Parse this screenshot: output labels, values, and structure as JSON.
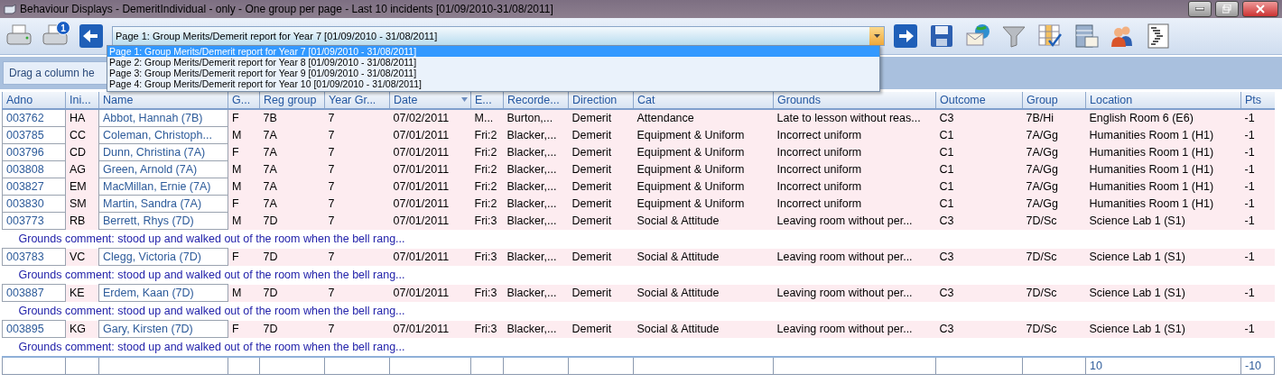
{
  "window": {
    "title": "Behaviour Displays - DemeritIndividual - only - One group per page - Last 10 incidents [01/09/2010-31/08/2011]"
  },
  "toolbar": {
    "print_badge": "1",
    "page_select": {
      "value": "Page 1: Group Merits/Demerit report for Year  7 [01/09/2010 - 31/08/2011]",
      "expanded": true,
      "options": [
        {
          "label": "Page 1: Group Merits/Demerit report for Year  7 [01/09/2010 - 31/08/2011]",
          "selected": true
        },
        {
          "label": "Page 2: Group Merits/Demerit report for Year  8 [01/09/2010 - 31/08/2011]",
          "selected": false
        },
        {
          "label": "Page 3: Group Merits/Demerit report for Year  9 [01/09/2010 - 31/08/2011]",
          "selected": false
        },
        {
          "label": "Page 4: Group Merits/Demerit report for Year 10 [01/09/2010 - 31/08/2011]",
          "selected": false
        }
      ]
    }
  },
  "group_panel": {
    "hint": "Drag a column he"
  },
  "table": {
    "columns": [
      {
        "label": "Adno",
        "link": true,
        "sorted": false
      },
      {
        "label": "Ini...",
        "link": false,
        "sorted": false
      },
      {
        "label": "Name",
        "link": true,
        "sorted": false
      },
      {
        "label": "G...",
        "link": false,
        "sorted": false
      },
      {
        "label": "Reg group",
        "link": false,
        "sorted": false
      },
      {
        "label": "Year Gr...",
        "link": false,
        "sorted": false
      },
      {
        "label": "Date",
        "link": false,
        "sorted": true
      },
      {
        "label": "E...",
        "link": false,
        "sorted": false
      },
      {
        "label": "Recorde...",
        "link": false,
        "sorted": false
      },
      {
        "label": "Direction",
        "link": false,
        "sorted": false
      },
      {
        "label": "Cat",
        "link": false,
        "sorted": false
      },
      {
        "label": "Grounds",
        "link": false,
        "sorted": false
      },
      {
        "label": "Outcome",
        "link": false,
        "sorted": false
      },
      {
        "label": "Group",
        "link": false,
        "sorted": false
      },
      {
        "label": "Location",
        "link": false,
        "sorted": false
      },
      {
        "label": "Pts",
        "link": false,
        "sorted": false
      }
    ],
    "rows": [
      {
        "cells": [
          "003762",
          "HA",
          "Abbot, Hannah (7B)",
          "F",
          "7B",
          "7",
          "07/02/2011",
          "M...",
          "Burton,...",
          "Demerit",
          "Attendance",
          "Late to lesson without reas...",
          "C3",
          "7B/Hi",
          "English Room 6 (E6)",
          "-1"
        ]
      },
      {
        "cells": [
          "003785",
          "CC",
          "Coleman, Christoph...",
          "M",
          "7A",
          "7",
          "07/01/2011",
          "Fri:2",
          "Blacker,...",
          "Demerit",
          "Equipment & Uniform",
          "Incorrect uniform",
          "C1",
          "7A/Gg",
          "Humanities Room 1 (H1)",
          "-1"
        ]
      },
      {
        "cells": [
          "003796",
          "CD",
          "Dunn, Christina (7A)",
          "F",
          "7A",
          "7",
          "07/01/2011",
          "Fri:2",
          "Blacker,...",
          "Demerit",
          "Equipment & Uniform",
          "Incorrect uniform",
          "C1",
          "7A/Gg",
          "Humanities Room 1 (H1)",
          "-1"
        ]
      },
      {
        "cells": [
          "003808",
          "AG",
          "Green, Arnold (7A)",
          "M",
          "7A",
          "7",
          "07/01/2011",
          "Fri:2",
          "Blacker,...",
          "Demerit",
          "Equipment & Uniform",
          "Incorrect uniform",
          "C1",
          "7A/Gg",
          "Humanities Room 1 (H1)",
          "-1"
        ]
      },
      {
        "cells": [
          "003827",
          "EM",
          "MacMillan, Ernie (7A)",
          "M",
          "7A",
          "7",
          "07/01/2011",
          "Fri:2",
          "Blacker,...",
          "Demerit",
          "Equipment & Uniform",
          "Incorrect uniform",
          "C1",
          "7A/Gg",
          "Humanities Room 1 (H1)",
          "-1"
        ]
      },
      {
        "cells": [
          "003830",
          "SM",
          "Martin, Sandra (7A)",
          "F",
          "7A",
          "7",
          "07/01/2011",
          "Fri:2",
          "Blacker,...",
          "Demerit",
          "Equipment & Uniform",
          "Incorrect uniform",
          "C1",
          "7A/Gg",
          "Humanities Room 1 (H1)",
          "-1"
        ]
      },
      {
        "cells": [
          "003773",
          "RB",
          "Berrett, Rhys (7D)",
          "M",
          "7D",
          "7",
          "07/01/2011",
          "Fri:3",
          "Blacker,...",
          "Demerit",
          "Social & Attitude",
          "Leaving room without per...",
          "C3",
          "7D/Sc",
          "Science Lab 1 (S1)",
          "-1"
        ],
        "comment": "Grounds comment: stood up and walked out of the room when the bell rang..."
      },
      {
        "cells": [
          "003783",
          "VC",
          "Clegg, Victoria (7D)",
          "F",
          "7D",
          "7",
          "07/01/2011",
          "Fri:3",
          "Blacker,...",
          "Demerit",
          "Social & Attitude",
          "Leaving room without per...",
          "C3",
          "7D/Sc",
          "Science Lab 1 (S1)",
          "-1"
        ],
        "comment": "Grounds comment: stood up and walked out of the room when the bell rang..."
      },
      {
        "cells": [
          "003887",
          "KE",
          "Erdem, Kaan (7D)",
          "M",
          "7D",
          "7",
          "07/01/2011",
          "Fri:3",
          "Blacker,...",
          "Demerit",
          "Social & Attitude",
          "Leaving room without per...",
          "C3",
          "7D/Sc",
          "Science Lab 1 (S1)",
          "-1"
        ],
        "comment": "Grounds comment: stood up and walked out of the room when the bell rang..."
      },
      {
        "cells": [
          "003895",
          "KG",
          "Gary, Kirsten (7D)",
          "F",
          "7D",
          "7",
          "07/01/2011",
          "Fri:3",
          "Blacker,...",
          "Demerit",
          "Social & Attitude",
          "Leaving room without per...",
          "C3",
          "7D/Sc",
          "Science Lab 1 (S1)",
          "-1"
        ],
        "comment": "Grounds comment: stood up and walked out of the room when the bell rang..."
      }
    ],
    "footer": {
      "location_total": "10",
      "pts_total": "-10"
    }
  }
}
